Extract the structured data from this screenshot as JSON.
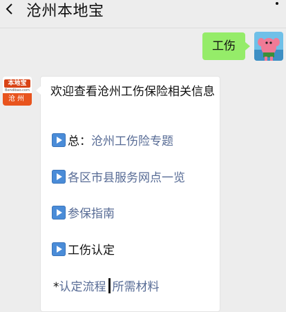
{
  "header": {
    "title": "沧州本地宝",
    "back_icon": "chevron-left-icon",
    "more_icon": "more-icon"
  },
  "outgoing": {
    "text": "工伤"
  },
  "bot": {
    "avatar_brand": "本地宝",
    "avatar_domain": "Bendibao.com",
    "avatar_city": "沧州",
    "intro": "欢迎查看沧州工伤保险相关信息",
    "items": [
      {
        "prefix": "总：",
        "label": "沧州工伤险专题"
      },
      {
        "prefix": "",
        "label": "各区市县服务网点一览"
      },
      {
        "prefix": "",
        "label": "参保指南"
      },
      {
        "prefix": "",
        "label": "工伤认定"
      }
    ],
    "sub": {
      "star": "*",
      "link1": "认定流程",
      "link2": "所需材料"
    }
  },
  "colors": {
    "link": "#576b95",
    "bubble_out": "#95ec69",
    "play_icon": "#4a8cd8"
  }
}
